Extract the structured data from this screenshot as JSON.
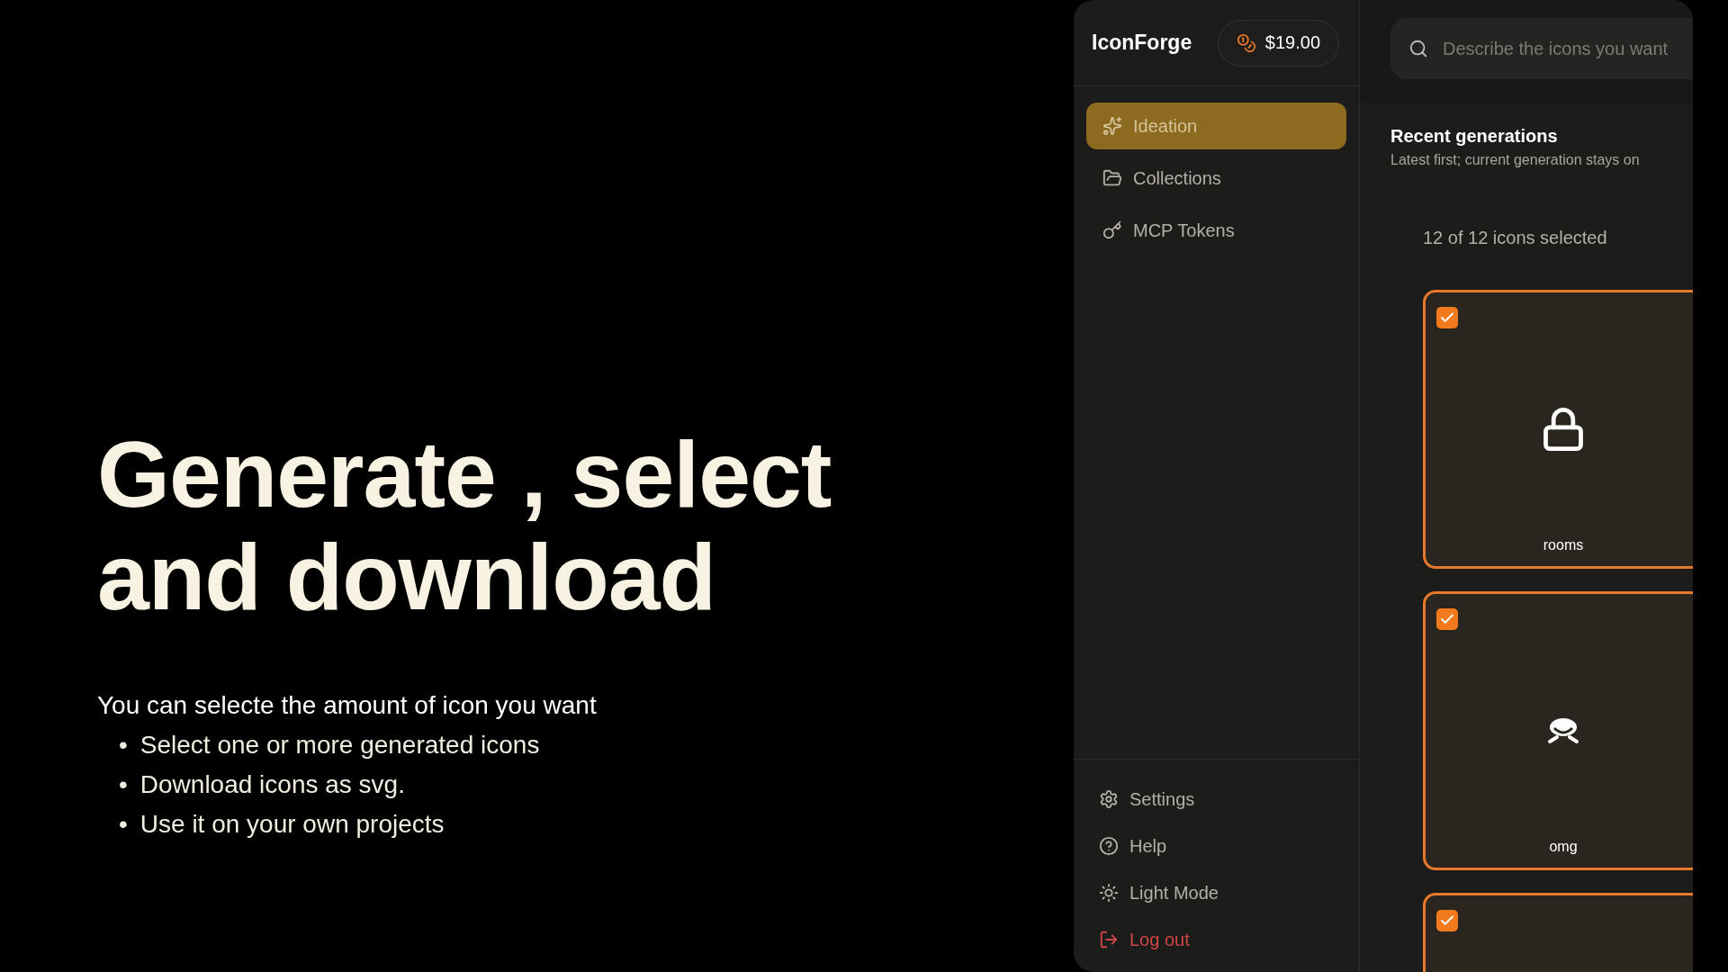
{
  "slide": {
    "headline_lines": [
      "Generate , select",
      "and download"
    ],
    "intro": "You can selecte the amount of icon you want",
    "bullets": [
      {
        "marker": "•",
        "text": "Select one or more generated icons"
      },
      {
        "marker": "•",
        "text": "Download icons as svg."
      },
      {
        "marker": "•",
        "text": "Use it on your own projects"
      }
    ]
  },
  "app": {
    "brand": "IconForge",
    "balance": "$19.00",
    "nav": [
      {
        "label": "Ideation",
        "selected": true
      },
      {
        "label": "Collections",
        "selected": false
      },
      {
        "label": "MCP Tokens",
        "selected": false
      }
    ],
    "footer_nav": [
      {
        "label": "Settings",
        "kind": "normal"
      },
      {
        "label": "Help",
        "kind": "normal"
      },
      {
        "label": "Light Mode",
        "kind": "normal"
      },
      {
        "label": "Log out",
        "kind": "danger"
      }
    ],
    "search": {
      "placeholder": "Describe the icons you want"
    },
    "section": {
      "title": "Recent generations",
      "subtitle": "Latest first; current generation stays on"
    },
    "selection_count": "12 of 12 icons selected",
    "cards": [
      {
        "label": "rooms",
        "checked": true
      },
      {
        "label": "omg",
        "checked": true
      },
      {
        "checked": true
      }
    ]
  }
}
